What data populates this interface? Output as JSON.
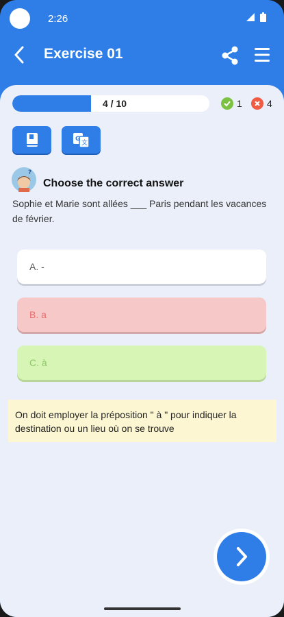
{
  "status": {
    "time": "2:26"
  },
  "appbar": {
    "title": "Exercise 01"
  },
  "progress": {
    "text": "4 / 10",
    "fraction": 0.4
  },
  "score": {
    "correct": "1",
    "wrong": "4"
  },
  "question": {
    "instruction": "Choose the correct answer",
    "text": "Sophie et Marie sont allées ___ Paris pendant les vacances de février."
  },
  "options": [
    {
      "label": "A. -",
      "state": "neutral"
    },
    {
      "label": "B. a",
      "state": "wrong"
    },
    {
      "label": "C. à",
      "state": "correct"
    }
  ],
  "explanation": "On doit employer la préposition \" à \" pour indiquer la destination ou un lieu où on se trouve",
  "icons": {
    "back": "arrow-left-icon",
    "share": "share-icon",
    "menu": "menu-icon",
    "book": "book-icon",
    "translate": "translate-icon",
    "next": "chevron-right-icon",
    "correct": "check-circle-icon",
    "wrong": "x-circle-icon"
  },
  "colors": {
    "primary": "#2f7ee8",
    "correct": "#7cc242",
    "wrong": "#f05b41",
    "explanation_bg": "#fcf6d2"
  }
}
